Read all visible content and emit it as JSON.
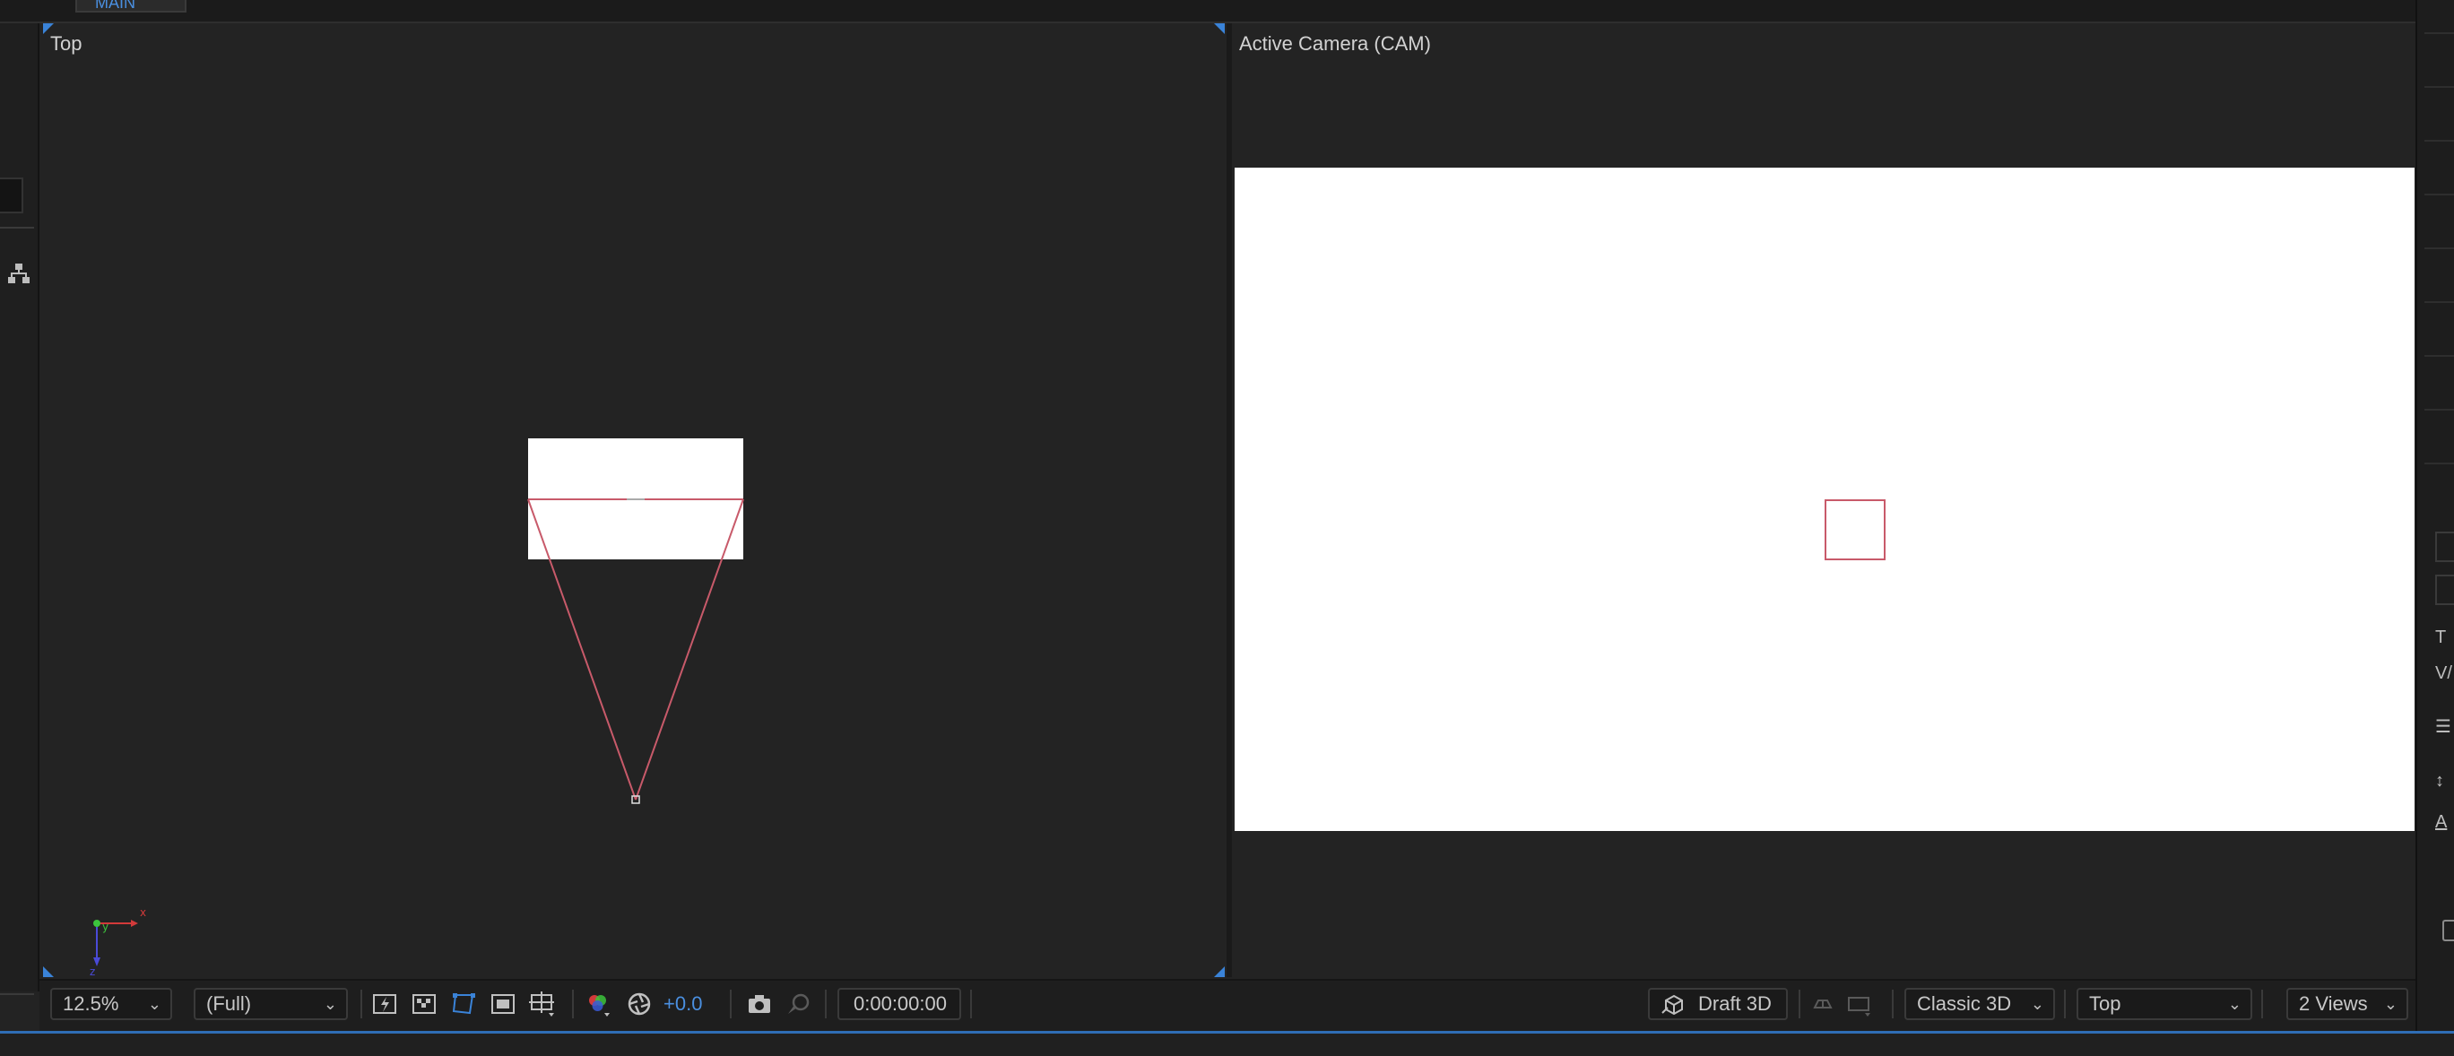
{
  "top_tab": {
    "label": "MAIN"
  },
  "views": {
    "left_label": "Top",
    "right_label": "Active Camera (CAM)"
  },
  "axis": {
    "x": "x",
    "y": "y",
    "z": "z"
  },
  "toolbar": {
    "zoom": "12.5%",
    "resolution": "(Full)",
    "exposure": "+0.0",
    "timecode": "0:00:00:00",
    "draft3d": "Draft 3D",
    "renderer": "Classic 3D",
    "view": "Top",
    "layout": "2 Views"
  },
  "right_strip_glyphs": [
    "T",
    "V/",
    "☰",
    "↕",
    "A"
  ],
  "colors": {
    "accent_blue": "#2f6db5",
    "exposure_blue": "#4a8fe0",
    "camera_wire": "#c85a6a",
    "canvas_white": "#ffffff",
    "background": "#232323"
  },
  "icons": {
    "flowchart": "flowchart-icon",
    "fast_previews": "fast-previews-icon",
    "transparency_grid": "transparency-grid-icon",
    "mask_path": "mask-path-icon",
    "region_of_interest": "region-of-interest-icon",
    "guides": "guides-grid-icon",
    "channels": "rgb-channels-icon",
    "reset_exposure": "reset-exposure-icon",
    "snapshot": "camera-snapshot-icon",
    "show_snapshot": "show-snapshot-icon",
    "draft3d": "draft-3d-icon"
  }
}
